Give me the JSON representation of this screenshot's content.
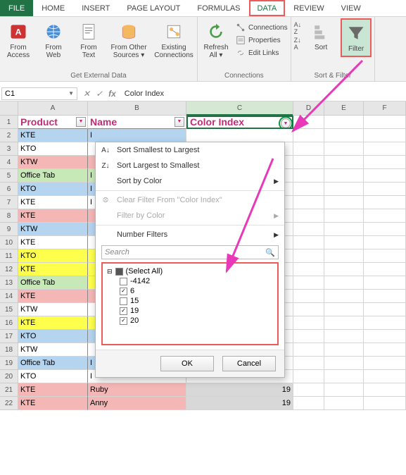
{
  "tabs": {
    "file": "FILE",
    "home": "HOME",
    "insert": "INSERT",
    "page_layout": "PAGE LAYOUT",
    "formulas": "FORMULAS",
    "data": "DATA",
    "review": "REVIEW",
    "view": "VIEW"
  },
  "ribbon": {
    "ext_data": {
      "label": "Get External Data",
      "access": "From Access",
      "web": "From Web",
      "text": "From Text",
      "other": "From Other Sources ▾",
      "existing": "Existing Connections"
    },
    "connections": {
      "label": "Connections",
      "refresh": "Refresh All ▾",
      "conn": "Connections",
      "props": "Properties",
      "links": "Edit Links"
    },
    "sort_filter": {
      "label": "Sort & Filter",
      "sort": "Sort",
      "filter": "Filter"
    }
  },
  "name_box": "C1",
  "formula": "Color Index",
  "columns": [
    "A",
    "B",
    "C",
    "D",
    "E",
    "F"
  ],
  "headers": {
    "a": "Product",
    "b": "Name",
    "c": "Color Index"
  },
  "rows": [
    {
      "r": 1,
      "a": "Product",
      "b": "Name",
      "c": "Color Index",
      "ac": "white",
      "bc": "white",
      "hdr": true
    },
    {
      "r": 2,
      "a": "KTE",
      "b": "I",
      "ac": "blue",
      "bc": "blue"
    },
    {
      "r": 3,
      "a": "KTO",
      "b": "",
      "ac": "white",
      "bc": "white"
    },
    {
      "r": 4,
      "a": "KTW",
      "b": "",
      "ac": "pink",
      "bc": "pink"
    },
    {
      "r": 5,
      "a": "Office Tab",
      "b": "I",
      "ac": "green",
      "bc": "green"
    },
    {
      "r": 6,
      "a": "KTO",
      "b": "I",
      "ac": "blue",
      "bc": "blue"
    },
    {
      "r": 7,
      "a": "KTE",
      "b": "I",
      "ac": "white",
      "bc": "white"
    },
    {
      "r": 8,
      "a": "KTE",
      "b": "",
      "ac": "pink",
      "bc": "pink"
    },
    {
      "r": 9,
      "a": "KTW",
      "b": "",
      "ac": "blue",
      "bc": "blue"
    },
    {
      "r": 10,
      "a": "KTE",
      "b": "",
      "ac": "white",
      "bc": "white"
    },
    {
      "r": 11,
      "a": "KTO",
      "b": "",
      "ac": "yellow",
      "bc": "yellow"
    },
    {
      "r": 12,
      "a": "KTE",
      "b": "",
      "ac": "yellow",
      "bc": "yellow"
    },
    {
      "r": 13,
      "a": "Office Tab",
      "b": "",
      "ac": "green",
      "bc": "yellow"
    },
    {
      "r": 14,
      "a": "KTE",
      "b": "",
      "ac": "pink",
      "bc": "pink"
    },
    {
      "r": 15,
      "a": "KTW",
      "b": "",
      "ac": "white",
      "bc": "white"
    },
    {
      "r": 16,
      "a": "KTE",
      "b": "",
      "ac": "yellow",
      "bc": "yellow"
    },
    {
      "r": 17,
      "a": "KTO",
      "b": "",
      "ac": "blue",
      "bc": "blue"
    },
    {
      "r": 18,
      "a": "KTW",
      "b": "",
      "ac": "white",
      "bc": "white"
    },
    {
      "r": 19,
      "a": "Office Tab",
      "b": "I",
      "ac": "blue",
      "bc": "blue"
    },
    {
      "r": 20,
      "a": "KTO",
      "b": "I",
      "ac": "white",
      "bc": "white"
    },
    {
      "r": 21,
      "a": "KTE",
      "b": "Ruby",
      "c": "19",
      "ac": "pink",
      "bc": "pink",
      "sel": true
    },
    {
      "r": 22,
      "a": "KTE",
      "b": "Anny",
      "c": "19",
      "ac": "pink",
      "bc": "pink",
      "sel": true
    }
  ],
  "dropdown": {
    "sort_asc": "Sort Smallest to Largest",
    "sort_desc": "Sort Largest to Smallest",
    "sort_color": "Sort by Color",
    "clear": "Clear Filter From \"Color Index\"",
    "filter_color": "Filter by Color",
    "number": "Number Filters",
    "search_ph": "Search",
    "select_all": "(Select All)",
    "opts": [
      {
        "label": "-4142",
        "checked": false
      },
      {
        "label": "6",
        "checked": true
      },
      {
        "label": "15",
        "checked": false
      },
      {
        "label": "19",
        "checked": true
      },
      {
        "label": "20",
        "checked": true
      }
    ],
    "ok": "OK",
    "cancel": "Cancel"
  }
}
